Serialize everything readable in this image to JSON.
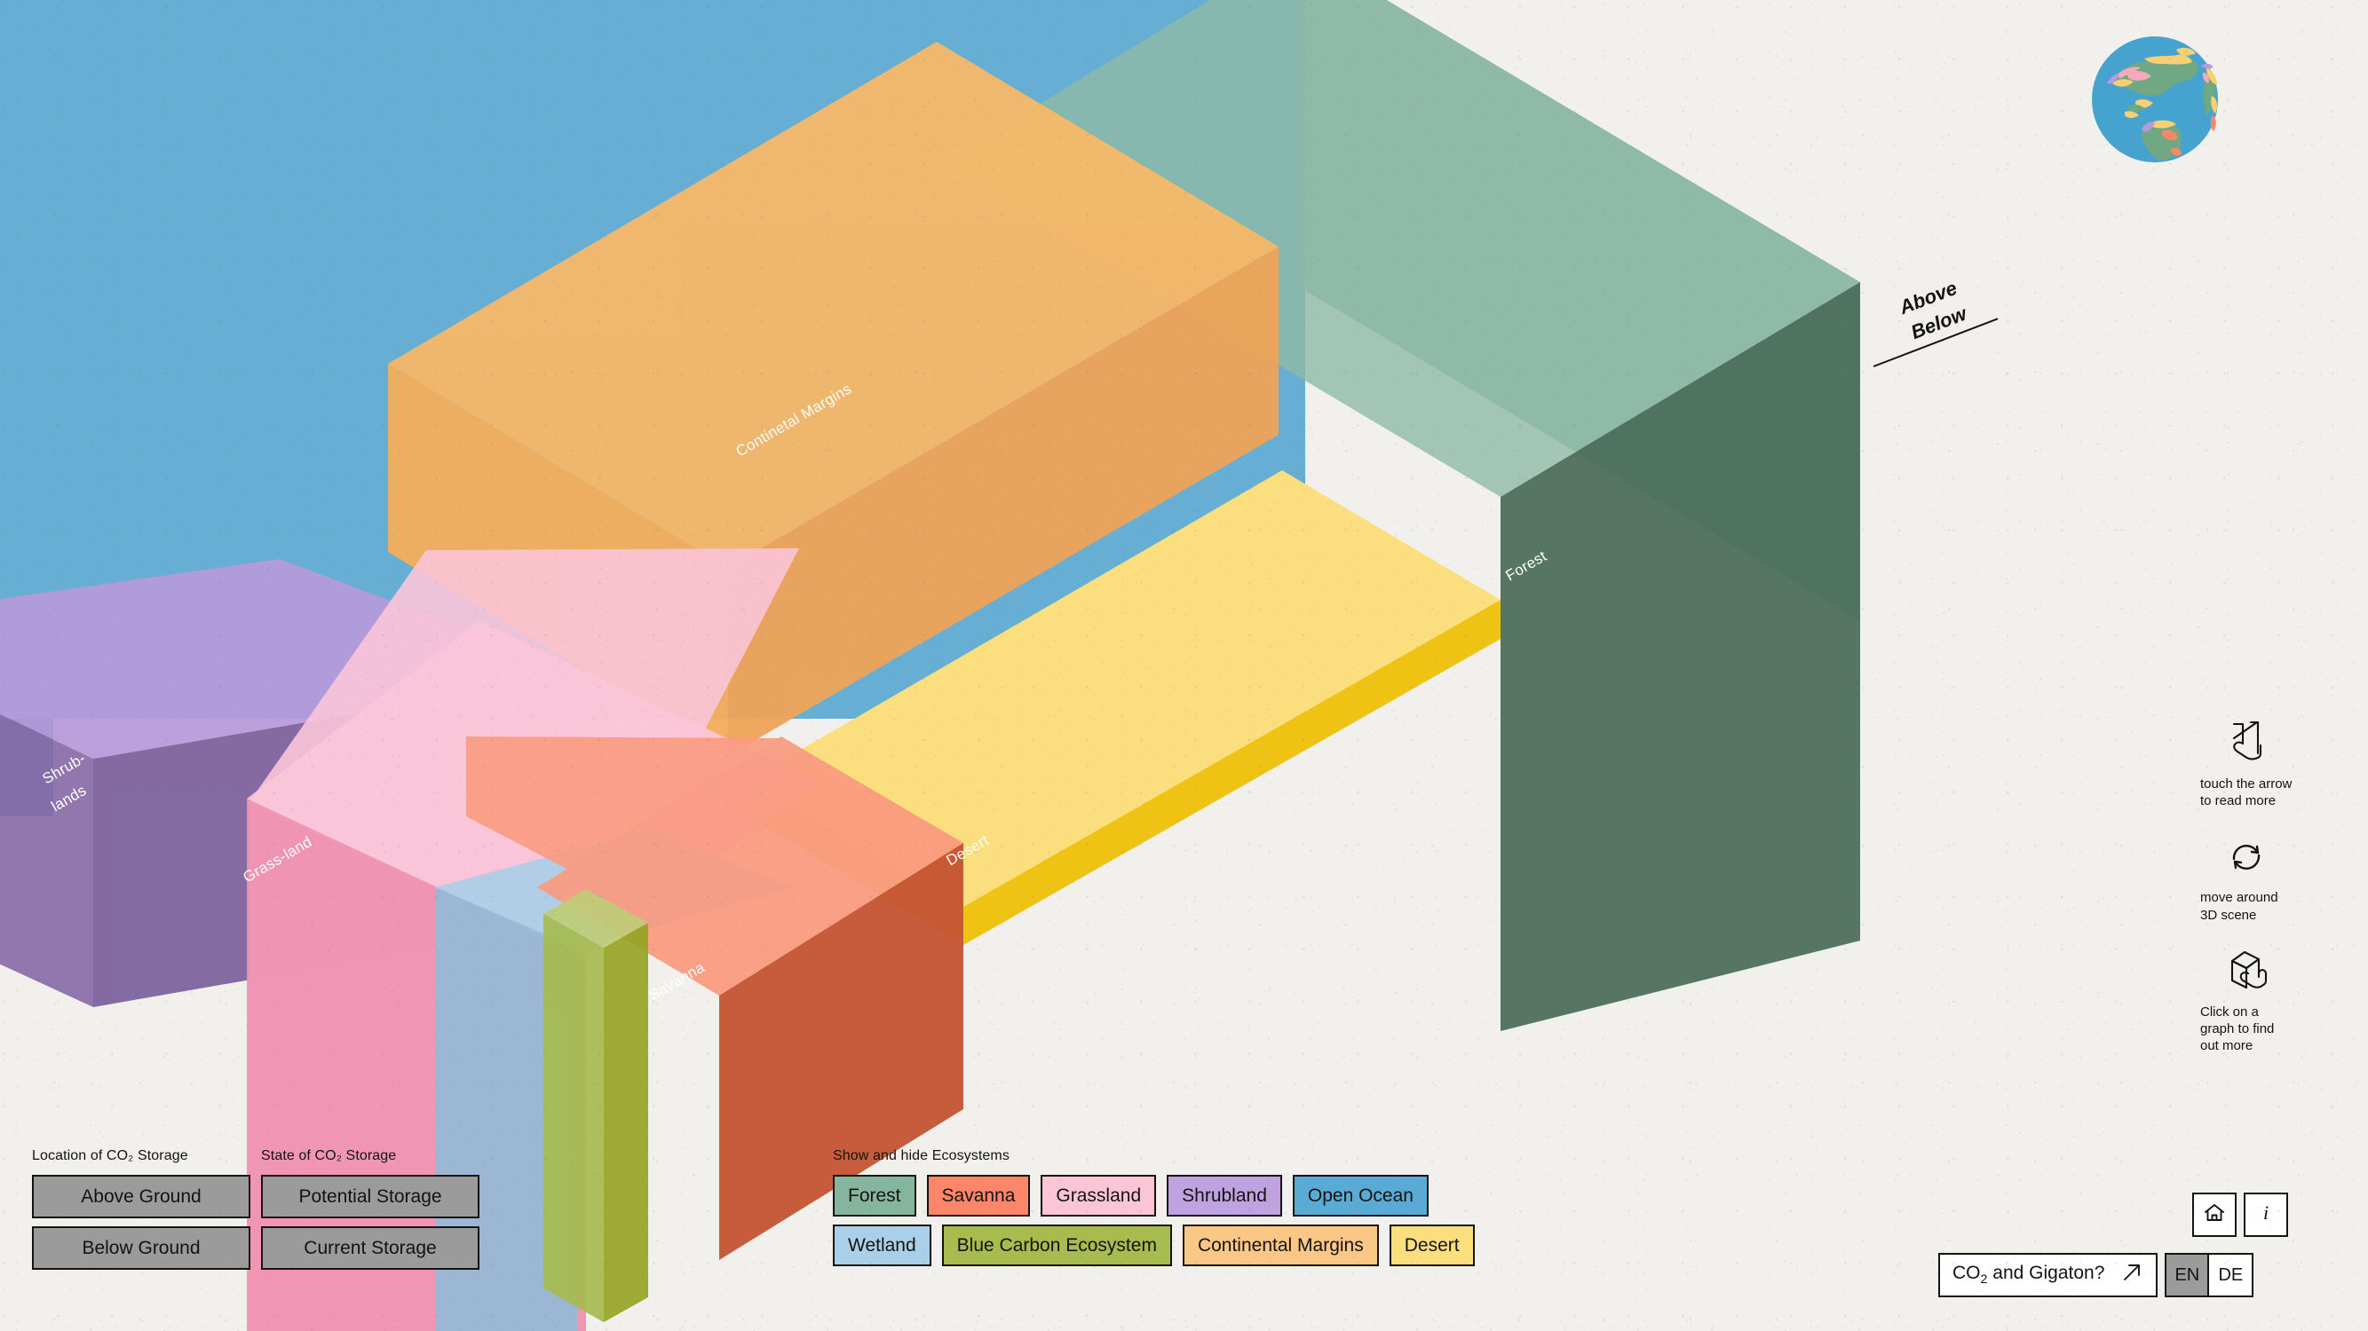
{
  "scene": {
    "labels": [
      {
        "name": "continental-margins",
        "text": "Continetal Margins"
      },
      {
        "name": "forest",
        "text": "Forest"
      },
      {
        "name": "shrublands-line1",
        "text": "Shrub-"
      },
      {
        "name": "shrublands-line2",
        "text": "lands"
      },
      {
        "name": "grassland",
        "text": "Grass-land"
      },
      {
        "name": "desert",
        "text": "Desert"
      },
      {
        "name": "savanna",
        "text": "Savanna"
      }
    ],
    "label_continental_margins": "Continetal Margins",
    "label_forest": "Forest",
    "label_shrublands_1": "Shrub-",
    "label_shrublands_2": "lands",
    "label_grassland": "Grass-land",
    "label_desert": "Desert",
    "label_savanna": "Savanna"
  },
  "annotation": {
    "above": "Above",
    "below": "Below"
  },
  "controls": {
    "location": {
      "title": "Location of CO₂ Storage",
      "buttons": [
        {
          "label": "Above Ground"
        },
        {
          "label": "Below Ground"
        }
      ]
    },
    "state": {
      "title": "State of CO₂ Storage",
      "buttons": [
        {
          "label": "Potential Storage"
        },
        {
          "label": "Current Storage"
        }
      ]
    }
  },
  "ecosystems": {
    "title": "Show and hide Ecosystems",
    "rows": [
      [
        {
          "label": "Forest",
          "color": "#85b49f"
        },
        {
          "label": "Savanna",
          "color": "#fc8669"
        },
        {
          "label": "Grassland",
          "color": "#fbc5d8"
        },
        {
          "label": "Shrubland",
          "color": "#bfa2e0"
        },
        {
          "label": "Open Ocean",
          "color": "#5aaad6"
        }
      ],
      [
        {
          "label": "Wetland",
          "color": "#a9d0e8"
        },
        {
          "label": "Blue Carbon Ecosystem",
          "color": "#a7bb4f"
        },
        {
          "label": "Continental Margins",
          "color": "#fbc787"
        },
        {
          "label": "Desert",
          "color": "#fbdf7e"
        }
      ]
    ]
  },
  "hints": [
    {
      "icon": "touch-arrow-icon",
      "text": "touch the arrow\nto read more"
    },
    {
      "icon": "rotate-icon",
      "text": "move around\n3D scene"
    },
    {
      "icon": "click-cube-icon",
      "text": "Click on a\ngraph to find\nout more"
    }
  ],
  "footer": {
    "home_icon": "home-icon",
    "info_icon": "info-icon",
    "co2_link_label": "CO₂ and Gigaton?",
    "co2_link_icon": "arrow-up-right-icon",
    "languages": [
      {
        "code": "EN",
        "active": true
      },
      {
        "code": "DE",
        "active": false
      }
    ]
  },
  "palette": {
    "background": "#f1f0ed",
    "ink": "#15130f",
    "ocean_top": "#5eaad2",
    "ocean_side": "#2d7e9e",
    "forest_top": "#84b3a0",
    "forest_side": "#4d6e5c",
    "margins_top": "#f6b05e",
    "margins_side": "#efa458",
    "desert_top": "#fbdf7e",
    "desert_side": "#efc314",
    "shrub_top": "#b79adc",
    "shrub_side": "#7b5f9b",
    "grass_top": "#fbc5d8",
    "grass_side": "#ef87a8",
    "savanna_top": "#fa9a80",
    "savanna_side": "#c4512f",
    "wetland_top": "#a9d0e8",
    "wetland_side": "#76a3bd",
    "bluecarbon_top": "#b4c364",
    "bluecarbon_side": "#96a524"
  }
}
